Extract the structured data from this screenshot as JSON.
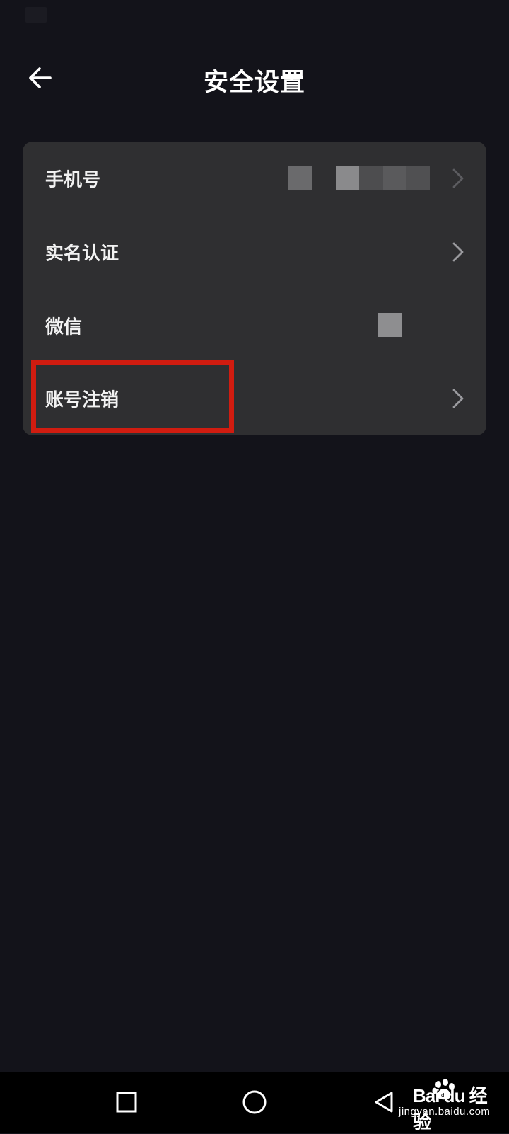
{
  "header": {
    "title": "安全设置",
    "back_icon": "arrow-left-icon"
  },
  "settings": [
    {
      "label": "手机号",
      "value": "[redacted]",
      "has_chevron": true
    },
    {
      "label": "实名认证",
      "has_chevron": true
    },
    {
      "label": "微信",
      "value": "[redacted]",
      "has_chevron": false
    },
    {
      "label": "账号注销",
      "has_chevron": true
    }
  ],
  "highlight": {
    "target": "账号注销",
    "color": "#d01c10"
  },
  "navbar": {
    "recents_icon": "square-icon",
    "home_icon": "circle-icon",
    "back_icon": "triangle-back-icon"
  },
  "watermark": {
    "brand": "Bai du 经验",
    "url": "jingyan.baidu.com"
  },
  "colors": {
    "background": "#13131a",
    "card": "#2f2f31",
    "text": "#f2f2f2",
    "chevron": "#9a9a9e",
    "highlight": "#d01c10"
  }
}
